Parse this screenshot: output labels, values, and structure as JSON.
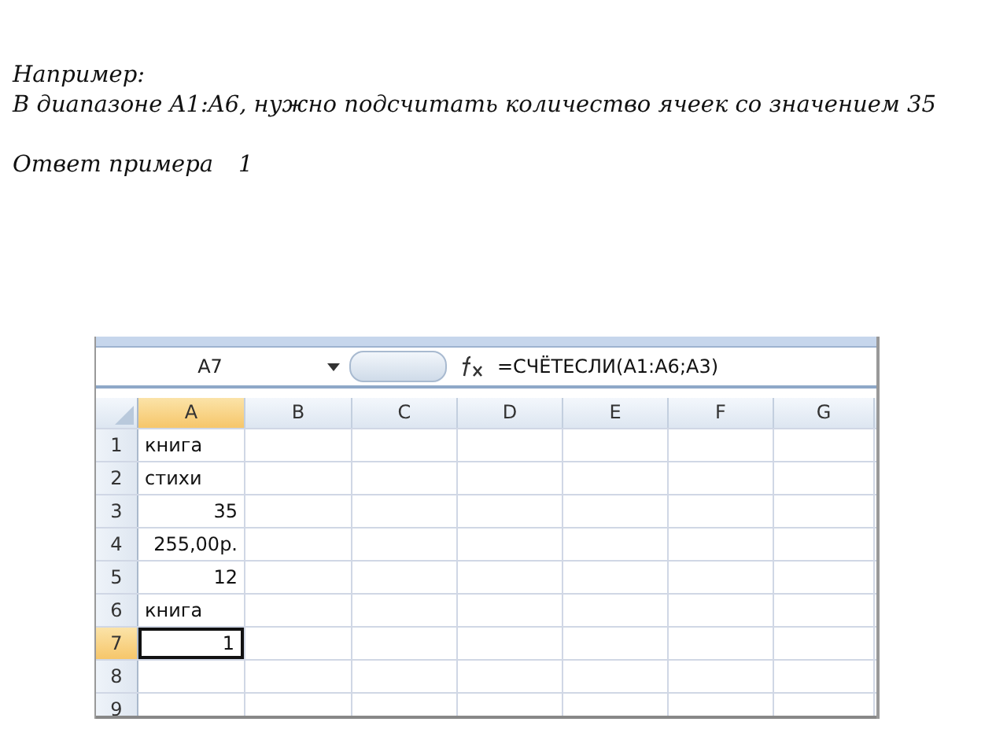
{
  "intro": {
    "title": "Например:",
    "task": "В диапазоне A1:A6, нужно подсчитать количество ячеек со значением 35",
    "answer_label": "Ответ примера",
    "answer_value": "1"
  },
  "spreadsheet": {
    "name_box": "A7",
    "formula": "=СЧЁТЕСЛИ(A1:A6;A3)",
    "columns": [
      {
        "label": "A",
        "selected": true
      },
      {
        "label": "B",
        "selected": false
      },
      {
        "label": "C",
        "selected": false
      },
      {
        "label": "D",
        "selected": false
      },
      {
        "label": "E",
        "selected": false
      },
      {
        "label": "F",
        "selected": false
      },
      {
        "label": "G",
        "selected": false
      }
    ],
    "rows": [
      {
        "label": "1",
        "selected": false,
        "value": "книга",
        "kind": "text"
      },
      {
        "label": "2",
        "selected": false,
        "value": "стихи",
        "kind": "text"
      },
      {
        "label": "3",
        "selected": false,
        "value": "35",
        "kind": "number"
      },
      {
        "label": "4",
        "selected": false,
        "value": "255,00р.",
        "kind": "number"
      },
      {
        "label": "5",
        "selected": false,
        "value": "12",
        "kind": "number"
      },
      {
        "label": "6",
        "selected": false,
        "value": "книга",
        "kind": "text"
      },
      {
        "label": "7",
        "selected": true,
        "value": "1",
        "kind": "number"
      },
      {
        "label": "8",
        "selected": false
      },
      {
        "label": "9",
        "selected": false
      }
    ]
  }
}
